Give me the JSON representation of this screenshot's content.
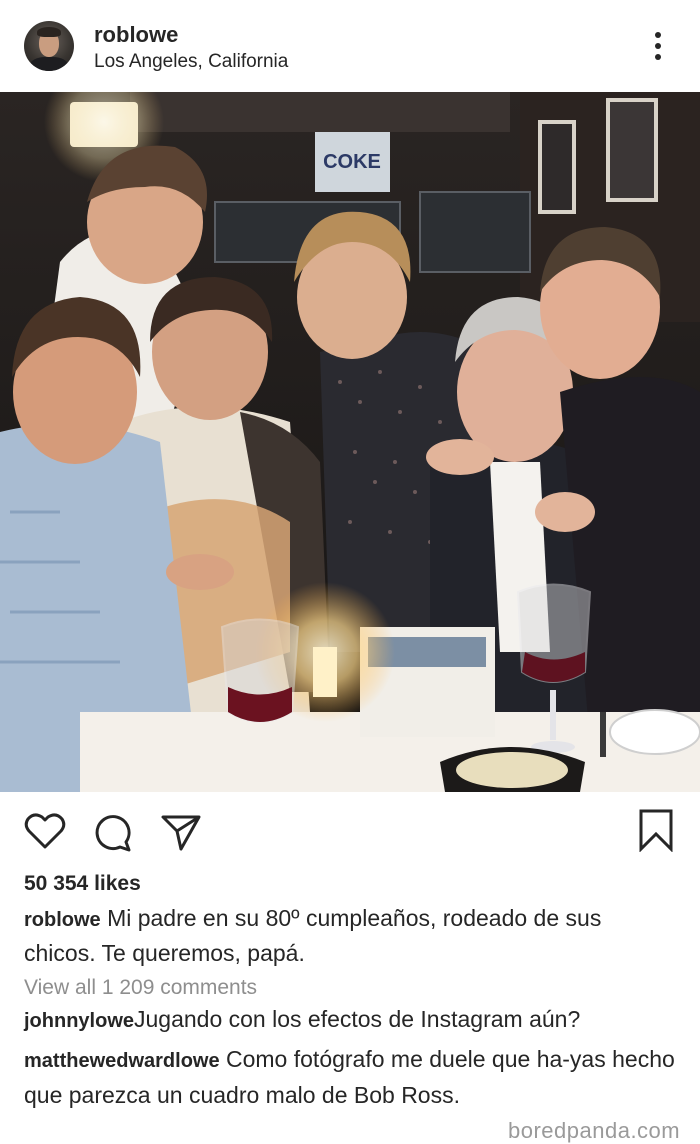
{
  "header": {
    "username": "roblowe",
    "location": "Los Angeles, California",
    "avatar_icon": "profile-photo",
    "more_icon": "vertical-dots-icon"
  },
  "photo": {
    "wall_sign_text": "COKE"
  },
  "actions": {
    "icons": [
      "heart-icon",
      "comment-icon",
      "share-icon",
      "bookmark-icon"
    ]
  },
  "post": {
    "likes": "50 354 likes",
    "caption_user": "roblowe",
    "caption_text": "Mi padre en su 80º cumpleaños, rodeado de sus chicos. Te queremos, papá.",
    "view_all": "View all 1 209 comments"
  },
  "comments": [
    {
      "user": "johnnylowe",
      "text": "Jugando con los efectos de Instagram aún?"
    },
    {
      "user": "matthewedwardlowe",
      "text": "Como fotógrafo me duele que ha-yas hecho que parezca un cuadro malo de Bob Ross."
    }
  ],
  "watermark": "boredpanda.com",
  "colors": {
    "text": "#262626",
    "muted": "#8e8e8e",
    "background": "#ffffff"
  }
}
